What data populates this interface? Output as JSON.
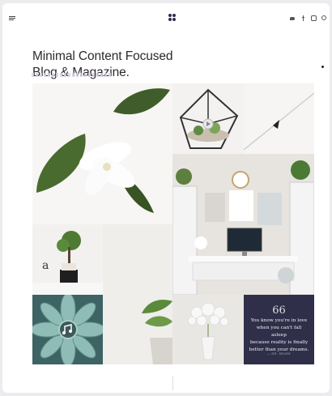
{
  "header": {
    "menu_icon": "hamburger-menu-icon",
    "logo_icon": "four-dots-logo-icon",
    "social_icons": [
      "twitter-icon",
      "facebook-icon",
      "instagram-icon",
      "search-icon"
    ]
  },
  "hero": {
    "title_line1": "Minimal Content Focused",
    "title_line2": "Blog & Magazine."
  },
  "gallery": {
    "tiles": [
      "white-flower",
      "terrarium",
      "pen",
      "desk",
      "bonsai",
      "potted-plant",
      "succulent",
      "flower-vase",
      "quote"
    ],
    "quote": {
      "mark": "66",
      "line1": "You know you're in love",
      "line2": "when you can't fall asleep",
      "line3": "because reality is finally",
      "line4": "better than your dreams.",
      "author": "— DR. SEUSS"
    }
  },
  "colors": {
    "accent_navy": "#2f2f4a",
    "text_dark": "#2a2a2a",
    "underline_lilac": "#d9cfe7"
  }
}
